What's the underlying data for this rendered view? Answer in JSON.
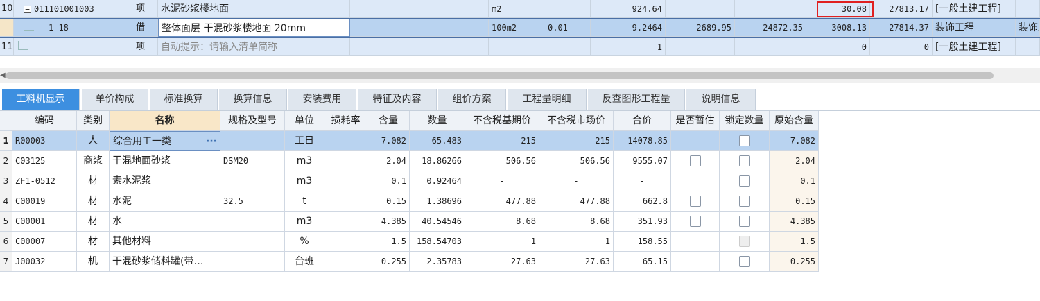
{
  "top_rows": [
    {
      "rownum": "10",
      "expander": "−",
      "code": "011101001003",
      "type": "项",
      "name": "水泥砂浆楼地面",
      "spec": "",
      "unit": "m2",
      "qty_expr": "",
      "qty": "924.64",
      "c1": "",
      "c2": "",
      "unit_price": "30.08",
      "total": "27813.17",
      "category": "[一般土建工程]",
      "extra": ""
    },
    {
      "rownum": "",
      "code": "1-18",
      "type": "借",
      "name": "整体面层 干混砂浆楼地面 20mm",
      "spec": "",
      "unit": "100m2",
      "qty_expr": "0.01",
      "qty": "9.2464",
      "c1": "2689.95",
      "c2": "24872.35",
      "unit_price": "3008.13",
      "total": "27814.37",
      "category": "装饰工程",
      "extra": "装饰工"
    },
    {
      "rownum": "11",
      "code": "",
      "type": "项",
      "name": "自动提示：请输入清单简称",
      "spec": "",
      "unit": "",
      "qty_expr": "",
      "qty": "1",
      "c1": "",
      "c2": "",
      "unit_price": "0",
      "total": "0",
      "category": "[一般土建工程]",
      "extra": ""
    }
  ],
  "tabs": [
    {
      "label": "工料机显示",
      "active": true
    },
    {
      "label": "单价构成"
    },
    {
      "label": "标准换算"
    },
    {
      "label": "换算信息"
    },
    {
      "label": "安装费用"
    },
    {
      "label": "特征及内容"
    },
    {
      "label": "组价方案"
    },
    {
      "label": "工程量明细"
    },
    {
      "label": "反查图形工程量"
    },
    {
      "label": "说明信息"
    }
  ],
  "columns": {
    "code": "编码",
    "category": "类别",
    "name": "名称",
    "spec": "规格及型号",
    "unit": "单位",
    "loss": "损耗率",
    "content": "含量",
    "qty": "数量",
    "base_price": "不含税基期价",
    "market_price": "不含税市场价",
    "total": "合价",
    "provisional": "是否暂估",
    "lock_qty": "锁定数量",
    "orig_content": "原始含量"
  },
  "rows": [
    {
      "rownum": "1",
      "code": "R00003",
      "category": "人",
      "name": "综合用工一类",
      "spec": "",
      "unit": "工日",
      "loss": "",
      "content": "7.082",
      "qty": "65.483",
      "base_price": "215",
      "market_price": "215",
      "total": "14078.85",
      "provisional": "",
      "lock": "box",
      "orig": "7.082"
    },
    {
      "rownum": "2",
      "code": "C03125",
      "category": "商浆",
      "name": "干混地面砂浆",
      "spec": "DSM20",
      "unit": "m3",
      "loss": "",
      "content": "2.04",
      "qty": "18.86266",
      "base_price": "506.56",
      "market_price": "506.56",
      "total": "9555.07",
      "provisional": "box",
      "lock": "box",
      "orig": "2.04"
    },
    {
      "rownum": "3",
      "code": "ZF1-0512",
      "category": "材",
      "name": "素水泥浆",
      "spec": "",
      "unit": "m3",
      "loss": "",
      "content": "0.1",
      "qty": "0.92464",
      "base_price": "-",
      "market_price": "-",
      "total": "-",
      "provisional": "",
      "lock": "box",
      "orig": "0.1"
    },
    {
      "rownum": "4",
      "code": "C00019",
      "category": "材",
      "name": "水泥",
      "spec": "32.5",
      "unit": "t",
      "loss": "",
      "content": "0.15",
      "qty": "1.38696",
      "base_price": "477.88",
      "market_price": "477.88",
      "total": "662.8",
      "provisional": "box",
      "lock": "box",
      "orig": "0.15"
    },
    {
      "rownum": "5",
      "code": "C00001",
      "category": "材",
      "name": "水",
      "spec": "",
      "unit": "m3",
      "loss": "",
      "content": "4.385",
      "qty": "40.54546",
      "base_price": "8.68",
      "market_price": "8.68",
      "total": "351.93",
      "provisional": "box",
      "lock": "box",
      "orig": "4.385"
    },
    {
      "rownum": "6",
      "code": "C00007",
      "category": "材",
      "name": "其他材料",
      "spec": "",
      "unit": "%",
      "loss": "",
      "content": "1.5",
      "qty": "158.54703",
      "base_price": "1",
      "market_price": "1",
      "total": "158.55",
      "provisional": "",
      "lock": "disabled",
      "orig": "1.5"
    },
    {
      "rownum": "7",
      "code": "J00032",
      "category": "机",
      "name": "干混砂浆储料罐(带…",
      "spec": "",
      "unit": "台班",
      "loss": "",
      "content": "0.255",
      "qty": "2.35783",
      "base_price": "27.63",
      "market_price": "27.63",
      "total": "65.15",
      "provisional": "",
      "lock": "box",
      "orig": "0.255"
    }
  ],
  "selected_cell_button": "···",
  "colors": {
    "tab_active": "#3d8fe0",
    "row_selected": "#b9d3f0",
    "highlight_box": "#e02020"
  }
}
